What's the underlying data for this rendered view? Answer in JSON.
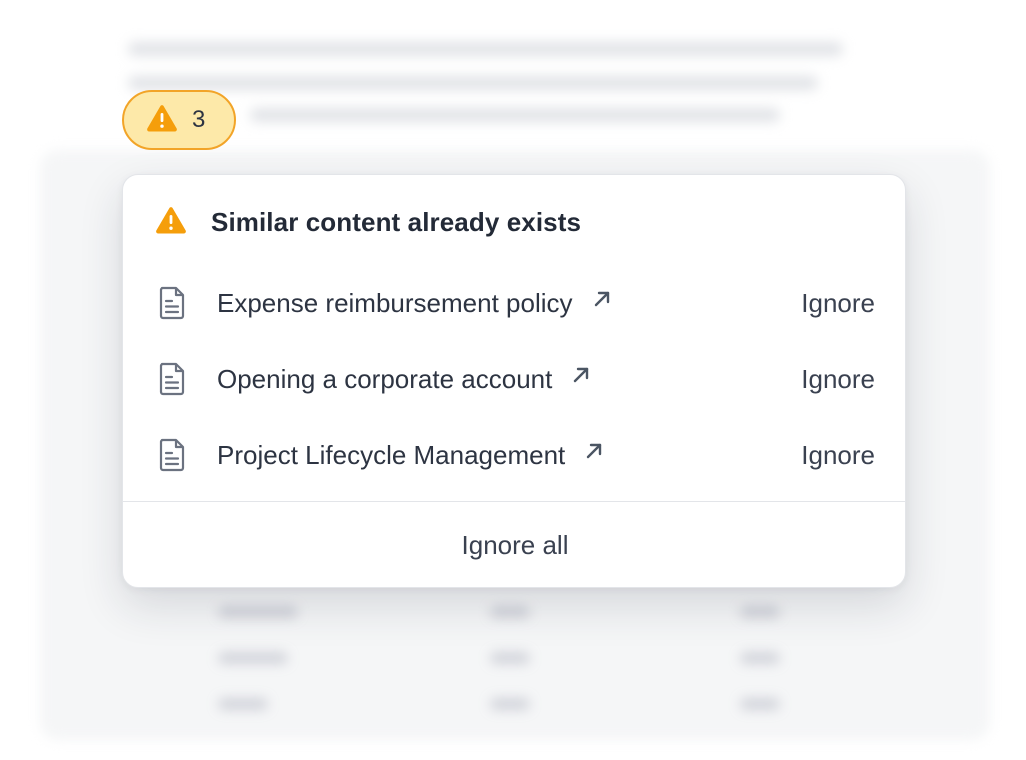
{
  "badge": {
    "icon": "warning-triangle-icon",
    "count": "3",
    "color": "#f59e0b",
    "background": "#fde9a9"
  },
  "popover": {
    "title": "Similar content already exists",
    "title_icon": "warning-triangle-icon",
    "items": [
      {
        "label": "Expense reimbursement policy",
        "icon": "document-icon",
        "link_icon": "external-arrow-icon",
        "action": "Ignore"
      },
      {
        "label": "Opening a corporate account",
        "icon": "document-icon",
        "link_icon": "external-arrow-icon",
        "action": "Ignore"
      },
      {
        "label": "Project Lifecycle Management",
        "icon": "document-icon",
        "link_icon": "external-arrow-icon",
        "action": "Ignore"
      }
    ],
    "footer_action": "Ignore all"
  }
}
